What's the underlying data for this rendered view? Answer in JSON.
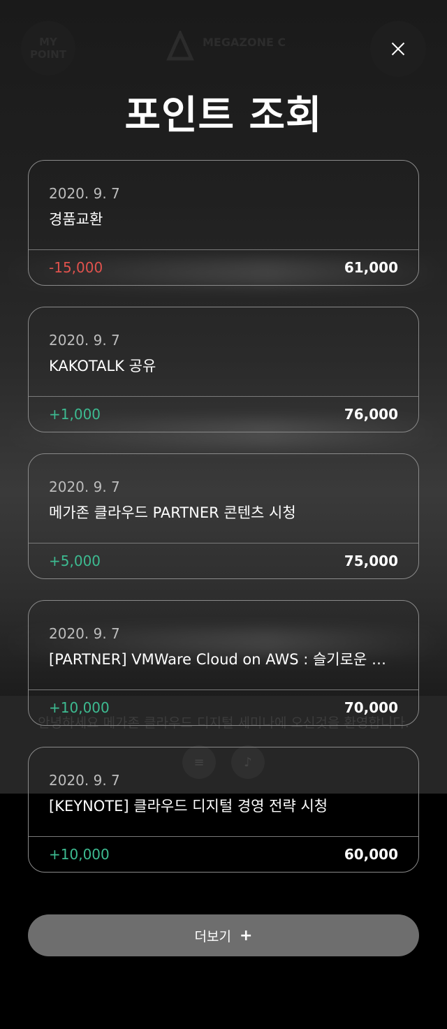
{
  "header": {
    "title": "포인트 조회",
    "my_point_label": "MY POINT",
    "logo_text": "MEGAZONE CLOUD"
  },
  "background": {
    "welcome_text": "안녕하세요 메가존 클라우드 디지털 세미나에 오신것을 환영합니다."
  },
  "history": [
    {
      "date": "2020. 9. 7",
      "description": "경품교환",
      "delta": "-15,000",
      "balance": "61,000"
    },
    {
      "date": "2020. 9. 7",
      "description": "KAKOTALK 공유",
      "delta": "+1,000",
      "balance": "76,000"
    },
    {
      "date": "2020. 9. 7",
      "description": "메가존 클라우드 PARTNER 콘텐츠 시청",
      "delta": "+5,000",
      "balance": "75,000"
    },
    {
      "date": "2020. 9. 7",
      "description": "[PARTNER] VMWare Cloud on AWS : 슬기로운 하이브리드 클라우드",
      "delta": "+10,000",
      "balance": "70,000"
    },
    {
      "date": "2020. 9. 7",
      "description": "[KEYNOTE] 클라우드 디지털 경영 전략 시청",
      "delta": "+10,000",
      "balance": "60,000"
    }
  ],
  "more_button": {
    "label": "더보기",
    "icon": "+"
  },
  "colors": {
    "negative": "#e0524d",
    "positive": "#3dbb91",
    "button": "#6e6e6e",
    "card_border": "#8a8a8a"
  }
}
